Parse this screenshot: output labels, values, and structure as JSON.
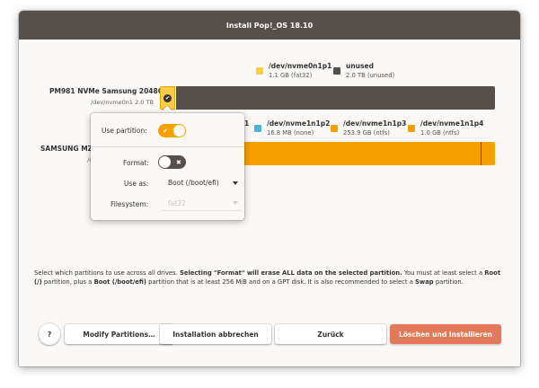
{
  "window": {
    "title": "Install Pop!_OS 18.10"
  },
  "legend_top": [
    {
      "path": "/dev/nvme0n1p1",
      "info": "1.1 GB (fat32)",
      "color": "#f8cd4c"
    },
    {
      "path": "unused",
      "info": "2.0 TB (unused)",
      "color": "#574f4a"
    }
  ],
  "disk1": {
    "name": "PM981 NVMe Samsung 2048GB",
    "path": "/dev/nvme0n1 2.0 TB"
  },
  "disk2": {
    "name": "SAMSUNG MZVL",
    "path": "/c"
  },
  "legend_second": [
    {
      "path": "1",
      "info": ""
    },
    {
      "path": "/dev/nvme1n1p2",
      "info": "16.8 MB (none)",
      "color": "#4ab7c8"
    },
    {
      "path": "/dev/nvme1n1p3",
      "info": "253.9 GB (ntfs)",
      "color": "#f6a000"
    },
    {
      "path": "/dev/nvme1n1p4",
      "info": "1.0 GB (ntfs)",
      "color": "#f6a000"
    }
  ],
  "popover": {
    "use_partition_label": "Use partition:",
    "use_partition_on": true,
    "format_label": "Format:",
    "format_on": false,
    "use_as_label": "Use as:",
    "use_as_value": "Boot (/boot/efi)",
    "filesystem_label": "Filesystem:",
    "filesystem_value": "fat32"
  },
  "info": {
    "t1": "Select which partitions to use across all drives. ",
    "b1": "Selecting \"Format\" will erase ALL data on the selected partition.",
    "t2": " You must at least select a ",
    "b2": "Root (/)",
    "t3": " partition, plus a ",
    "b3": "Boot (/boot/efi)",
    "t4": " partition that is at least 256 MiB and on a GPT disk. It is also recommended to select a ",
    "b4": "Swap",
    "t5": " partition."
  },
  "buttons": {
    "help": "?",
    "modify": "Modify Partitions…",
    "cancel": "Installation abbrechen",
    "back": "Zurück",
    "install": "Löschen und Installieren"
  },
  "colors": {
    "accent": "#f6a000",
    "efi_selected": "#f8cd4c",
    "unused": "#574f4a",
    "titlebar": "#574f4a",
    "primary_button": "#e1795a"
  }
}
